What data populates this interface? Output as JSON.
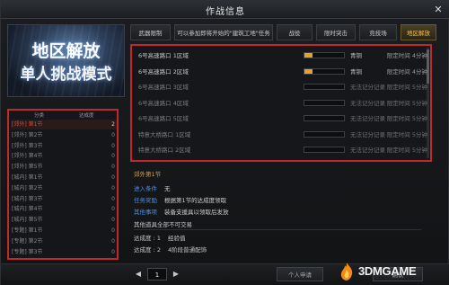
{
  "window": {
    "title": "作战信息",
    "close_glyph": "✕"
  },
  "banner": {
    "line1": "地区解放",
    "line2": "单人挑战模式"
  },
  "tabs": [
    {
      "label": "武器限制"
    },
    {
      "label": "可以参加即将开始的\"建筑工地\"任务"
    },
    {
      "label": "战役"
    },
    {
      "label": "限时突击"
    },
    {
      "label": "竞技场"
    },
    {
      "label": "地区解放"
    }
  ],
  "tasks": [
    {
      "name": "6号高速路口 1区域",
      "progress": 0.2,
      "status": "青铜",
      "time": "限定时间 4分钟"
    },
    {
      "name": "6号高速路口 2区域",
      "progress": 0.2,
      "status": "青铜",
      "time": "限定时间 4分钟"
    },
    {
      "name": "6号高速路口 3区域",
      "progress": 0,
      "status": "无法记分记录",
      "time": "限定时间 5分钟"
    },
    {
      "name": "6号高速路口 4区域",
      "progress": 0,
      "status": "无法记分记录",
      "time": "限定时间 5分钟"
    },
    {
      "name": "6号高速路口 5区域",
      "progress": 0,
      "status": "无法记分记录",
      "time": "限定时间 5分钟"
    },
    {
      "name": "特意大桥路口 1区域",
      "progress": 0,
      "status": "无法记分记录",
      "time": "限定时间 5分钟"
    },
    {
      "name": "特意大桥路口 2区域",
      "progress": 0,
      "status": "无法记分记录",
      "time": "限定时间 5分钟"
    }
  ],
  "left_list": {
    "col_name": "分类",
    "col_value": "达成度",
    "items": [
      {
        "name": "[郊外] 第1节",
        "value": "2"
      },
      {
        "name": "[郊外] 第2节",
        "value": "0"
      },
      {
        "name": "[郊外] 第3节",
        "value": "0"
      },
      {
        "name": "[郊外] 第4节",
        "value": "0"
      },
      {
        "name": "[郊外] 第5节",
        "value": "0"
      },
      {
        "name": "[城内] 第1节",
        "value": "0"
      },
      {
        "name": "[城内] 第2节",
        "value": "0"
      },
      {
        "name": "[城内] 第3节",
        "value": "0"
      },
      {
        "name": "[城内] 第4节",
        "value": "0"
      },
      {
        "name": "[城内] 第5节",
        "value": "0"
      },
      {
        "name": "[专题] 第1节",
        "value": "0"
      },
      {
        "name": "[专题] 第2节",
        "value": "0"
      },
      {
        "name": "[专题] 第3节",
        "value": "0"
      }
    ]
  },
  "detail": {
    "title": "郊外第1节",
    "rows": [
      {
        "key": "进入条件",
        "value": "无"
      },
      {
        "key": "任务奖励",
        "value": "根据第1节的达成度领取"
      },
      {
        "key": "其他事项",
        "value": "装备支援具以领取后发放"
      }
    ],
    "note": "其他道具全部不可交易",
    "levels": [
      {
        "label": "达成度 : 1",
        "value": "经验值"
      },
      {
        "label": "达成度 : 2",
        "value": "4阶段普通配饰"
      }
    ]
  },
  "pager": {
    "prev": "◀",
    "page": "1",
    "next": "▶"
  },
  "bottom_buttons": {
    "personal": "个人申请",
    "confirm": "确认"
  },
  "watermark": {
    "text": "3DMGAME"
  },
  "colors": {
    "accent": "#f2c04a",
    "highlight": "#c0282c",
    "progress": "#e7a02a",
    "link": "#4c8fe0"
  }
}
